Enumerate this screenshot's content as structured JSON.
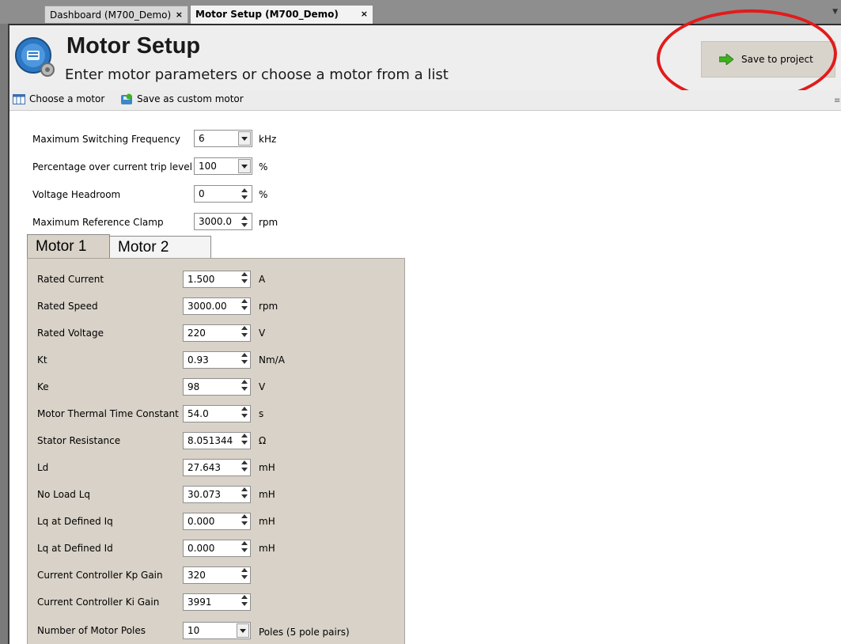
{
  "tabs": [
    {
      "label": "Dashboard (M700_Demo)",
      "close": "×"
    },
    {
      "label": "Motor Setup (M700_Demo)",
      "close": "×"
    }
  ],
  "header": {
    "title": "Motor Setup",
    "subtitle": "Enter motor parameters or choose a motor from a list",
    "save_label": "Save to project"
  },
  "toolbar": {
    "choose_label": "Choose a motor",
    "save_custom_label": "Save as custom motor"
  },
  "general": [
    {
      "label": "Maximum Switching Frequency",
      "value": "6",
      "unit": "kHz",
      "control": "dropdown"
    },
    {
      "label": "Percentage over current trip level",
      "value": "100",
      "unit": "%",
      "control": "dropdown"
    },
    {
      "label": "Voltage Headroom",
      "value": "0",
      "unit": "%",
      "control": "spin"
    },
    {
      "label": "Maximum Reference Clamp",
      "value": "3000.0",
      "unit": "rpm",
      "control": "spin"
    }
  ],
  "motor_tabs": [
    "Motor 1",
    "Motor 2"
  ],
  "motor1": [
    {
      "label": "Rated Current",
      "value": "1.500",
      "unit": "A",
      "control": "spin"
    },
    {
      "label": "Rated Speed",
      "value": "3000.00",
      "unit": "rpm",
      "control": "spin"
    },
    {
      "label": "Rated Voltage",
      "value": "220",
      "unit": "V",
      "control": "spin"
    },
    {
      "label": "Kt",
      "value": "0.93",
      "unit": "Nm/A",
      "control": "spin"
    },
    {
      "label": "Ke",
      "value": "98",
      "unit": "V",
      "control": "spin"
    },
    {
      "label": "Motor Thermal Time Constant",
      "value": "54.0",
      "unit": "s",
      "control": "spin"
    },
    {
      "label": "Stator Resistance",
      "value": "8.051344",
      "unit": "Ω",
      "control": "spin"
    },
    {
      "label": "Ld",
      "value": "27.643",
      "unit": "mH",
      "control": "spin"
    },
    {
      "label": "No Load Lq",
      "value": "30.073",
      "unit": "mH",
      "control": "spin"
    },
    {
      "label": "Lq at Defined Iq",
      "value": "0.000",
      "unit": "mH",
      "control": "spin"
    },
    {
      "label": "Lq at Defined Id",
      "value": "0.000",
      "unit": "mH",
      "control": "spin"
    },
    {
      "label": "Current Controller Kp Gain",
      "value": "320",
      "unit": "",
      "control": "spin"
    },
    {
      "label": "Current Controller Ki Gain",
      "value": "3991",
      "unit": "",
      "control": "spin"
    },
    {
      "label": "Number of Motor Poles",
      "value": "10",
      "unit": "Poles (5 pole pairs)",
      "control": "dropdown"
    }
  ],
  "colors": {
    "annotation_circle": "#e21b1b",
    "save_arrow": "#3fb21f",
    "panel_bg": "#d8d2c8"
  },
  "icons": {
    "logo": "motor-setup-logo-icon",
    "save": "green-arrow-icon",
    "choose": "motor-list-icon",
    "save_custom": "save-motor-icon"
  }
}
